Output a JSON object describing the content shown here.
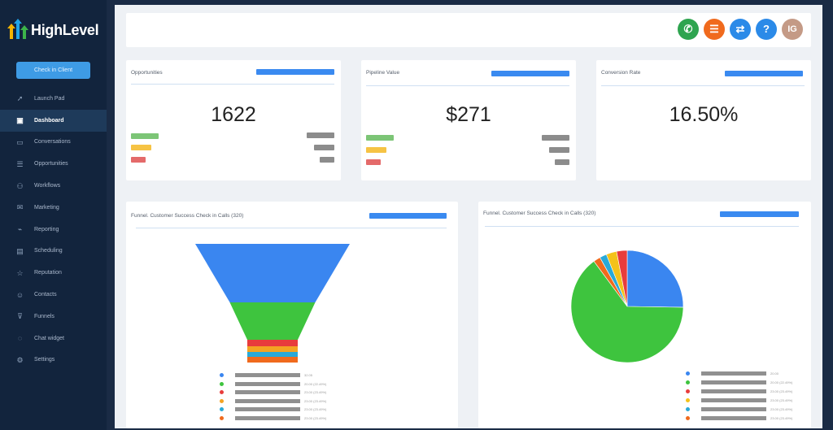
{
  "app": {
    "brand": "HighLevel"
  },
  "sidebar": {
    "check_button": "Check in Client",
    "items": [
      {
        "label": "Launch Pad",
        "icon": "rocket-icon",
        "active": false
      },
      {
        "label": "Dashboard",
        "icon": "dashboard-icon",
        "active": true
      },
      {
        "label": "Conversations",
        "icon": "chat-icon",
        "active": false
      },
      {
        "label": "Opportunities",
        "icon": "filter-icon",
        "active": false
      },
      {
        "label": "Workflows",
        "icon": "workflow-icon",
        "active": false
      },
      {
        "label": "Marketing",
        "icon": "mail-icon",
        "active": false
      },
      {
        "label": "Reporting",
        "icon": "chart-icon",
        "active": false
      },
      {
        "label": "Scheduling",
        "icon": "calendar-icon",
        "active": false
      },
      {
        "label": "Reputation",
        "icon": "star-icon",
        "active": false
      },
      {
        "label": "Contacts",
        "icon": "user-icon",
        "active": false
      },
      {
        "label": "Funnels",
        "icon": "funnel-icon",
        "active": false
      },
      {
        "label": "Chat widget",
        "icon": "chat-bubble-icon",
        "active": false
      },
      {
        "label": "Settings",
        "icon": "gear-icon",
        "active": false
      }
    ]
  },
  "topbar": {
    "icons": [
      {
        "name": "phone-icon",
        "color": "#2ea44f",
        "glyph": "✆"
      },
      {
        "name": "list-icon",
        "color": "#f06a1d",
        "glyph": "☰"
      },
      {
        "name": "swap-icon",
        "color": "#2b8ae8",
        "glyph": "⇄"
      },
      {
        "name": "help-icon",
        "color": "#2b8ae8",
        "glyph": "?"
      }
    ],
    "avatar": {
      "initials": "IG",
      "color": "#c49a86"
    }
  },
  "cards": {
    "opportunities": {
      "title": "Opportunities",
      "value": "1622"
    },
    "pipeline": {
      "title": "Pipeline Value",
      "value": "$271"
    },
    "conversion": {
      "title": "Conversion Rate",
      "value": "16.50%"
    }
  },
  "funnel_panel": {
    "title": "Funnel.   Customer Success Check in Calls (320)"
  },
  "pie_panel": {
    "title": "Funnel.   Customer Success Check in Calls (320)"
  },
  "chart_data": [
    {
      "type": "funnel",
      "stage_colors": [
        "#3a86f0",
        "#3ec43e",
        "#e83c3c",
        "#f4a322",
        "#29a9d8",
        "#f06a1d"
      ],
      "values": [
        100,
        46,
        7,
        5,
        4,
        4
      ],
      "legend_values": [
        "32.05",
        "20.00 (22.49%)",
        "23.00 (23.49%)",
        "23.00 (23.49%)",
        "23.00 (23.49%)",
        "23.00 (23.49%)"
      ]
    },
    {
      "type": "pie",
      "colors": [
        "#3a86f0",
        "#3ec43e",
        "#f06a1d",
        "#29a9d8",
        "#f4c21a",
        "#e83c3c"
      ],
      "values": [
        25,
        64,
        2,
        2,
        3,
        3
      ],
      "legend_values": [
        "20.00",
        "20.00 (22.49%)",
        "23.00 (23.49%)",
        "23.00 (23.49%)",
        "23.00 (23.49%)",
        "23.00 (23.49%)"
      ]
    }
  ]
}
